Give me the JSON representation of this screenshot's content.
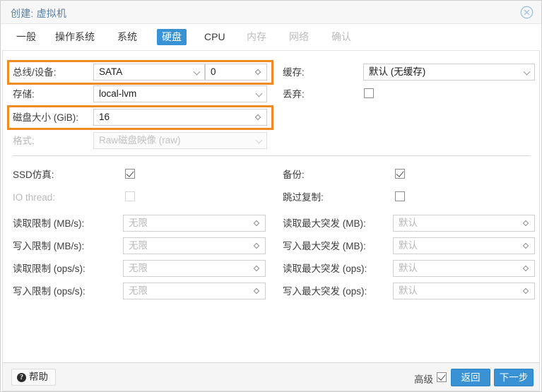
{
  "window": {
    "title": "创建: 虚拟机",
    "close_icon": "close-circle-icon"
  },
  "tabs": [
    {
      "label": "一般",
      "state": "enabled"
    },
    {
      "label": "操作系统",
      "state": "enabled"
    },
    {
      "label": "系统",
      "state": "enabled"
    },
    {
      "label": "硬盘",
      "state": "active"
    },
    {
      "label": "CPU",
      "state": "enabled"
    },
    {
      "label": "内存",
      "state": "disabled"
    },
    {
      "label": "网络",
      "state": "disabled"
    },
    {
      "label": "确认",
      "state": "disabled"
    }
  ],
  "form": {
    "bus_device": {
      "label": "总线/设备:",
      "bus_value": "SATA",
      "device_value": "0",
      "highlighted": true
    },
    "storage": {
      "label": "存储:",
      "value": "local-lvm"
    },
    "disk_size": {
      "label": "磁盘大小 (GiB):",
      "value": "16",
      "highlighted": true
    },
    "format": {
      "label": "格式:",
      "value": "Raw磁盘映像 (raw)",
      "disabled": true
    },
    "cache": {
      "label": "缓存:",
      "value": "默认 (无缓存)"
    },
    "discard": {
      "label": "丢弃:",
      "checked": false
    },
    "ssd_emulation": {
      "label": "SSD仿真:",
      "checked": true
    },
    "io_thread": {
      "label": "IO thread:",
      "checked": false,
      "disabled": true
    },
    "backup": {
      "label": "备份:",
      "checked": true
    },
    "skip_replication": {
      "label": "跳过复制:",
      "checked": false
    },
    "limits_left": [
      {
        "label": "读取限制 (MB/s):",
        "value": "无限"
      },
      {
        "label": "写入限制 (MB/s):",
        "value": "无限"
      },
      {
        "label": "读取限制 (ops/s):",
        "value": "无限"
      },
      {
        "label": "写入限制 (ops/s):",
        "value": "无限"
      }
    ],
    "limits_right": [
      {
        "label": "读取最大突发 (MB):",
        "value": "默认"
      },
      {
        "label": "写入最大突发 (MB):",
        "value": "默认"
      },
      {
        "label": "读取最大突发 (ops):",
        "value": "默认"
      },
      {
        "label": "写入最大突发 (ops):",
        "value": "默认"
      }
    ]
  },
  "footer": {
    "help_label": "帮助",
    "help_icon": "question-mark-icon",
    "advanced_label": "高级",
    "advanced_checked": true,
    "back_label": "返回",
    "next_label": "下一步"
  },
  "colors": {
    "accent": "#3892d4",
    "highlight": "#f08a23",
    "title_text": "#5a7fa6"
  }
}
